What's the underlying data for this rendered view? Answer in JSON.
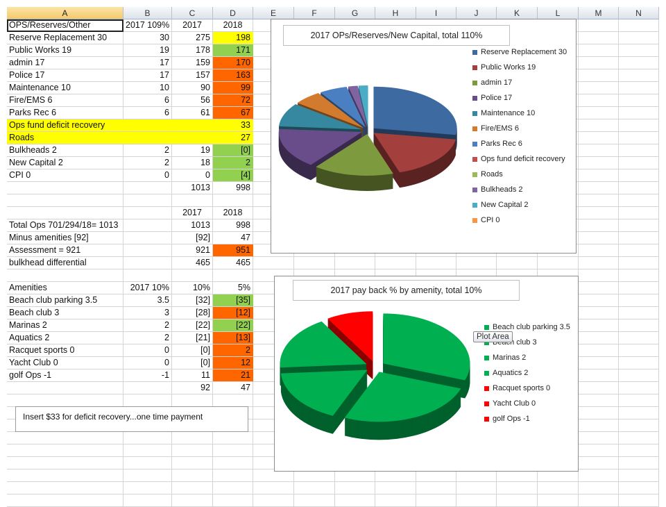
{
  "columns": [
    "A",
    "B",
    "C",
    "D",
    "E",
    "F",
    "G",
    "H",
    "I",
    "J",
    "K",
    "L",
    "M",
    "N"
  ],
  "colors": {
    "yellow": "#ffff00",
    "green": "#92d050",
    "orange": "#ff6600"
  },
  "rows": [
    {
      "cells": [
        "OPS/Reserves/Other",
        "2017 109%",
        "2017",
        "2018"
      ],
      "fills": [
        "",
        "",
        "",
        ""
      ],
      "header": true
    },
    {
      "cells": [
        "Reserve  Replacement 30",
        "30",
        "275",
        "198"
      ],
      "fills": [
        "",
        "",
        "",
        "yellow"
      ]
    },
    {
      "cells": [
        "Public Works 19",
        "19",
        "178",
        "171"
      ],
      "fills": [
        "",
        "",
        "",
        "green"
      ]
    },
    {
      "cells": [
        "admin 17",
        "17",
        "159",
        "170"
      ],
      "fills": [
        "",
        "",
        "",
        "orange"
      ]
    },
    {
      "cells": [
        "Police 17",
        "17",
        "157",
        "163"
      ],
      "fills": [
        "",
        "",
        "",
        "orange"
      ]
    },
    {
      "cells": [
        "Maintenance 10",
        "10",
        "90",
        "99"
      ],
      "fills": [
        "",
        "",
        "",
        "orange"
      ]
    },
    {
      "cells": [
        "Fire/EMS 6",
        "6",
        "56",
        "72"
      ],
      "fills": [
        "",
        "",
        "",
        "orange"
      ]
    },
    {
      "cells": [
        "Parks Rec 6",
        "6",
        "61",
        "67"
      ],
      "fills": [
        "",
        "",
        "",
        "orange"
      ]
    },
    {
      "cells": [
        "Ops fund deficit recovery",
        "",
        "",
        "33"
      ],
      "fills": [
        "yellow",
        "yellow",
        "yellow",
        "yellow"
      ]
    },
    {
      "cells": [
        "Roads",
        "",
        "",
        "27"
      ],
      "fills": [
        "yellow",
        "yellow",
        "yellow",
        "yellow"
      ]
    },
    {
      "cells": [
        "Bulkheads 2",
        "2",
        "19",
        "[0]"
      ],
      "fills": [
        "",
        "",
        "",
        "green"
      ]
    },
    {
      "cells": [
        "New Capital 2",
        "2",
        "18",
        "2"
      ],
      "fills": [
        "",
        "",
        "",
        "green"
      ]
    },
    {
      "cells": [
        "CPI 0",
        "0",
        "0",
        "[4]"
      ],
      "fills": [
        "",
        "",
        "",
        "green"
      ]
    },
    {
      "cells": [
        "",
        "",
        "1013",
        "998"
      ],
      "fills": [
        "",
        "",
        "",
        ""
      ]
    },
    {
      "cells": [
        "",
        "",
        "",
        ""
      ],
      "fills": [
        "",
        "",
        "",
        ""
      ]
    },
    {
      "cells": [
        "",
        "",
        "2017",
        "2018"
      ],
      "fills": [
        "",
        "",
        "",
        ""
      ],
      "header": true
    },
    {
      "cells": [
        "Total Ops 701/294/18= 1013",
        "",
        "1013",
        "998"
      ],
      "fills": [
        "",
        "",
        "",
        ""
      ]
    },
    {
      "cells": [
        "Minus amenities [92]",
        "",
        "[92]",
        "47"
      ],
      "fills": [
        "",
        "",
        "",
        ""
      ]
    },
    {
      "cells": [
        "Assessment  = 921",
        "",
        "921",
        "951"
      ],
      "fills": [
        "",
        "",
        "",
        "orange"
      ]
    },
    {
      "cells": [
        "bulkhead differential",
        "",
        "465",
        "465"
      ],
      "fills": [
        "",
        "",
        "",
        ""
      ]
    },
    {
      "cells": [
        "",
        "",
        "",
        ""
      ],
      "fills": [
        "",
        "",
        "",
        ""
      ]
    },
    {
      "cells": [
        "Amenities",
        "2017 10%",
        "10%",
        "5%"
      ],
      "fills": [
        "",
        "",
        "",
        ""
      ]
    },
    {
      "cells": [
        "Beach club parking 3.5",
        "3.5",
        "[32]",
        "[35]"
      ],
      "fills": [
        "",
        "",
        "",
        "green"
      ]
    },
    {
      "cells": [
        "Beach club 3",
        "3",
        "[28]",
        "[12]"
      ],
      "fills": [
        "",
        "",
        "",
        "orange"
      ]
    },
    {
      "cells": [
        "Marinas 2",
        "2",
        "[22]",
        "[22]"
      ],
      "fills": [
        "",
        "",
        "",
        "green"
      ]
    },
    {
      "cells": [
        "Aquatics 2",
        "2",
        "[21]",
        "[13]"
      ],
      "fills": [
        "",
        "",
        "",
        "orange"
      ]
    },
    {
      "cells": [
        "Racquet sports  0",
        "0",
        "[0]",
        "2"
      ],
      "fills": [
        "",
        "",
        "",
        "orange"
      ]
    },
    {
      "cells": [
        "Yacht Club 0",
        "0",
        "[0]",
        "12"
      ],
      "fills": [
        "",
        "",
        "",
        "orange"
      ]
    },
    {
      "cells": [
        "golf Ops -1",
        "-1",
        "11",
        "21"
      ],
      "fills": [
        "",
        "",
        "",
        "orange"
      ]
    },
    {
      "cells": [
        "",
        "",
        "92",
        "47"
      ],
      "fills": [
        "",
        "",
        "",
        ""
      ]
    }
  ],
  "note": "Insert $33 for deficit recovery...one time payment",
  "tooltip": "Plot Area",
  "chart_data": [
    {
      "type": "pie",
      "title": "2017 OPs/Reserves/New Capital, total 110%",
      "legend_position": "right",
      "categories": [
        "Reserve  Replacement 30",
        "Public Works 19",
        "admin 17",
        "Police 17",
        "Maintenance 10",
        "Fire/EMS 6",
        "Parks Rec 6",
        "Ops fund deficit recovery",
        "Roads",
        "Bulkheads 2",
        "New Capital 2",
        "CPI 0"
      ],
      "values": [
        30,
        19,
        17,
        17,
        10,
        6,
        6,
        0,
        0,
        2,
        2,
        0
      ],
      "colors": [
        "#3d6aa1",
        "#a33f3c",
        "#7e9a3e",
        "#694d8a",
        "#35889f",
        "#d27a2e",
        "#4a7fc1",
        "#c0504d",
        "#9bbb59",
        "#8064a2",
        "#4bacc6",
        "#f79646"
      ]
    },
    {
      "type": "pie",
      "title": "2017 pay back % by amenity, total 10%",
      "legend_position": "right",
      "categories": [
        "Beach club parking 3.5",
        "Beach club 3",
        "Marinas 2",
        "Aquatics 2",
        "Racquet sports  0",
        "Yacht Club 0",
        "golf Ops -1"
      ],
      "values": [
        3.5,
        3,
        2,
        2,
        0,
        0,
        -1
      ],
      "colors": [
        "#00b050",
        "#00b050",
        "#00b050",
        "#00b050",
        "#ff0000",
        "#ff0000",
        "#ff0000"
      ]
    }
  ]
}
